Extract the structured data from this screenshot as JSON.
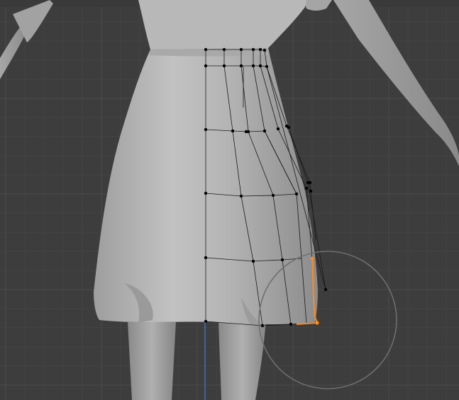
{
  "viewport": {
    "background_color": "#3d3d3d",
    "grid_minor_color": "#434343",
    "grid_major_color": "#4b4b4b",
    "model_color": "#b3b3b3",
    "model_shade_color": "#8f8f8f",
    "wire_color": "#1a1a1a",
    "vertex_color": "#000000",
    "selected_color": "#ff8a1f",
    "brush_circle_color": "#6e6e6e",
    "z_axis_color": "#3f7fd6"
  },
  "tool": {
    "name": "proportional-edit-falloff-circle"
  }
}
